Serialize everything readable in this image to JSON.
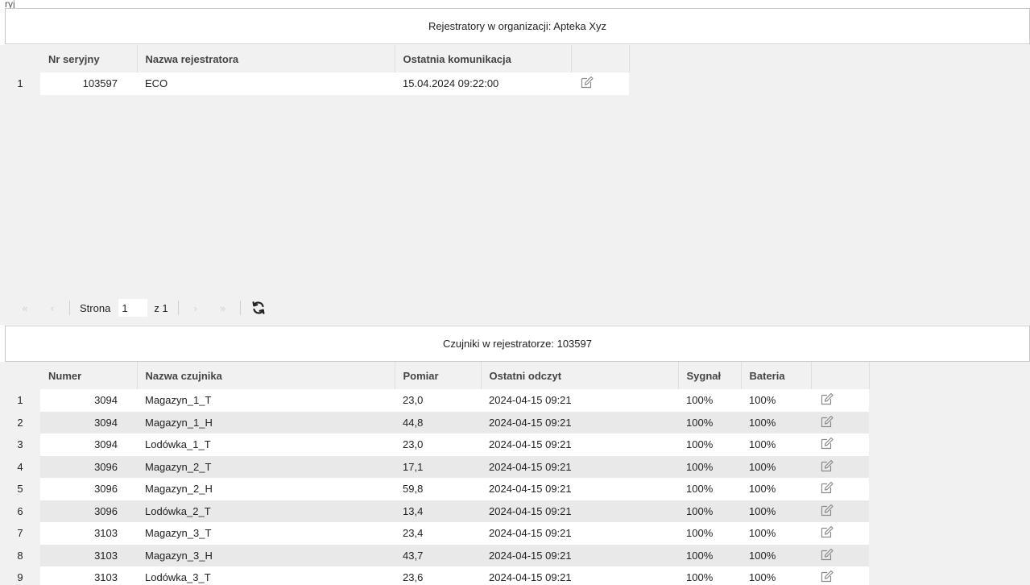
{
  "top_fragment": "ryj",
  "registrars": {
    "title": "Rejestratory w organizacji: Apteka Xyz",
    "columns": [
      "",
      "Nr seryjny",
      "Nazwa rejestratora",
      "Ostatnia komunikacja",
      ""
    ],
    "rows": [
      {
        "index": "1",
        "serial": "103597",
        "name": "ECO",
        "last_comm": "15.04.2024 09:22:00",
        "edit_icon": "edit-icon"
      }
    ]
  },
  "pager": {
    "first_icon": "«",
    "prev_icon": "‹",
    "page_label": "Strona",
    "page_value": "1",
    "of_label": "z 1",
    "next_icon": "›",
    "last_icon": "»",
    "refresh_icon": "refresh-icon"
  },
  "sensors": {
    "title": "Czujniki w rejestratorze: 103597",
    "columns": [
      "",
      "Numer",
      "Nazwa czujnika",
      "Pomiar",
      "Ostatni odczyt",
      "Sygnał",
      "Bateria",
      ""
    ],
    "rows": [
      {
        "index": "1",
        "number": "3094",
        "name": "Magazyn_1_T",
        "measure": "23,0",
        "last_read": "2024-04-15 09:21",
        "signal": "100%",
        "battery": "100%"
      },
      {
        "index": "2",
        "number": "3094",
        "name": "Magazyn_1_H",
        "measure": "44,8",
        "last_read": "2024-04-15 09:21",
        "signal": "100%",
        "battery": "100%"
      },
      {
        "index": "3",
        "number": "3094",
        "name": "Lodówka_1_T",
        "measure": "23,0",
        "last_read": "2024-04-15 09:21",
        "signal": "100%",
        "battery": "100%"
      },
      {
        "index": "4",
        "number": "3096",
        "name": "Magazyn_2_T",
        "measure": "17,1",
        "last_read": "2024-04-15 09:21",
        "signal": "100%",
        "battery": "100%"
      },
      {
        "index": "5",
        "number": "3096",
        "name": "Magazyn_2_H",
        "measure": "59,8",
        "last_read": "2024-04-15 09:21",
        "signal": "100%",
        "battery": "100%"
      },
      {
        "index": "6",
        "number": "3096",
        "name": "Lodówka_2_T",
        "measure": "13,4",
        "last_read": "2024-04-15 09:21",
        "signal": "100%",
        "battery": "100%"
      },
      {
        "index": "7",
        "number": "3103",
        "name": "Magazyn_3_T",
        "measure": "23,4",
        "last_read": "2024-04-15 09:21",
        "signal": "100%",
        "battery": "100%"
      },
      {
        "index": "8",
        "number": "3103",
        "name": "Magazyn_3_H",
        "measure": "43,7",
        "last_read": "2024-04-15 09:21",
        "signal": "100%",
        "battery": "100%"
      },
      {
        "index": "9",
        "number": "3103",
        "name": "Lodówka_3_T",
        "measure": "23,6",
        "last_read": "2024-04-15 09:21",
        "signal": "100%",
        "battery": "100%"
      }
    ]
  },
  "colors": {
    "header_bg": "#f1f1f1",
    "row_alt": "#e9e9e9",
    "border": "#c9c9c9",
    "icon": "#8a8a8a"
  }
}
